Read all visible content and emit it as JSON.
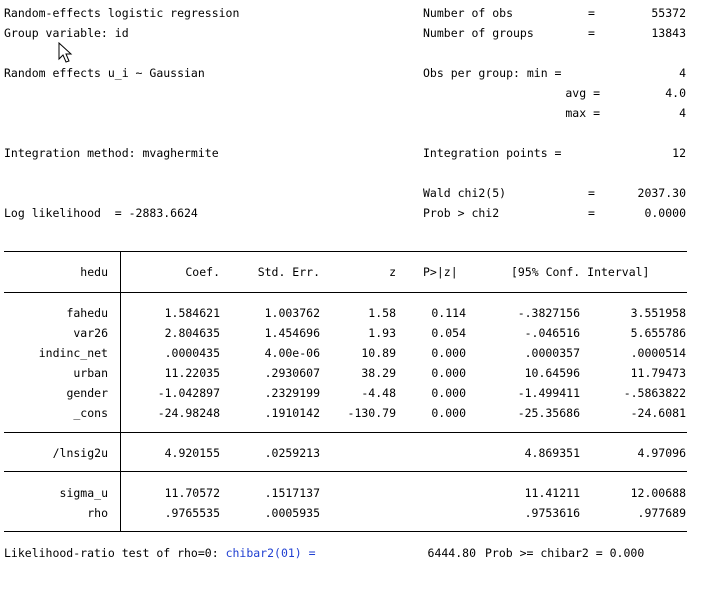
{
  "header": {
    "title": "Random-effects logistic regression",
    "group_var": "Group variable: id",
    "re_dist": "Random effects u_i ~ Gaussian",
    "integration_method": "Integration method: mvaghermite",
    "log_likelihood": "Log likelihood  = -2883.6624",
    "stats": [
      {
        "label": "Number of obs",
        "eq": "=",
        "value": "55372"
      },
      {
        "label": "Number of groups",
        "eq": "=",
        "value": "13843"
      },
      {
        "label": "Obs per group: min =",
        "eq": "",
        "value": "4"
      },
      {
        "label": "avg =",
        "eq": "",
        "value": "4.0"
      },
      {
        "label": "max =",
        "eq": "",
        "value": "4"
      },
      {
        "label": "Integration points =",
        "eq": "",
        "value": "12"
      },
      {
        "label": "Wald chi2(5)",
        "eq": "=",
        "value": "2037.30"
      },
      {
        "label": "Prob > chi2",
        "eq": "=",
        "value": "0.0000"
      }
    ]
  },
  "table": {
    "depvar": "hedu",
    "columns": [
      "Coef.",
      "Std. Err.",
      "z",
      "P>|z|",
      "[95% Conf. Interval]"
    ],
    "rows": [
      {
        "name": "fahedu",
        "coef": "1.584621",
        "se": "1.003762",
        "z": "1.58",
        "p": "0.114",
        "lo": "-.3827156",
        "hi": "3.551958"
      },
      {
        "name": "var26",
        "coef": "2.804635",
        "se": "1.454696",
        "z": "1.93",
        "p": "0.054",
        "lo": "-.046516",
        "hi": "5.655786"
      },
      {
        "name": "indinc_net",
        "coef": ".0000435",
        "se": "4.00e-06",
        "z": "10.89",
        "p": "0.000",
        "lo": ".0000357",
        "hi": ".0000514"
      },
      {
        "name": "urban",
        "coef": "11.22035",
        "se": ".2930607",
        "z": "38.29",
        "p": "0.000",
        "lo": "10.64596",
        "hi": "11.79473"
      },
      {
        "name": "gender",
        "coef": "-1.042897",
        "se": ".2329199",
        "z": "-4.48",
        "p": "0.000",
        "lo": "-1.499411",
        "hi": "-.5863822"
      },
      {
        "name": "_cons",
        "coef": "-24.98248",
        "se": ".1910142",
        "z": "-130.79",
        "p": "0.000",
        "lo": "-25.35686",
        "hi": "-24.6081"
      }
    ],
    "lnsig": {
      "name": "/lnsig2u",
      "coef": "4.920155",
      "se": ".0259213",
      "lo": "4.869351",
      "hi": "4.97096"
    },
    "aux": [
      {
        "name": "sigma_u",
        "coef": "11.70572",
        "se": ".1517137",
        "lo": "11.41211",
        "hi": "12.00688"
      },
      {
        "name": "rho",
        "coef": ".9765535",
        "se": ".0005935",
        "lo": ".9753616",
        "hi": ".977689"
      }
    ]
  },
  "footer": {
    "lr_label": "Likelihood-ratio test of rho=0: ",
    "chibar_label": "chibar2(01) =",
    "chibar_value": "6444.80",
    "prob_label": "Prob >= chibar2 = 0.000"
  },
  "colors": {
    "link": "#1f3fd1"
  },
  "icons": [
    "mouse-cursor-icon"
  ]
}
